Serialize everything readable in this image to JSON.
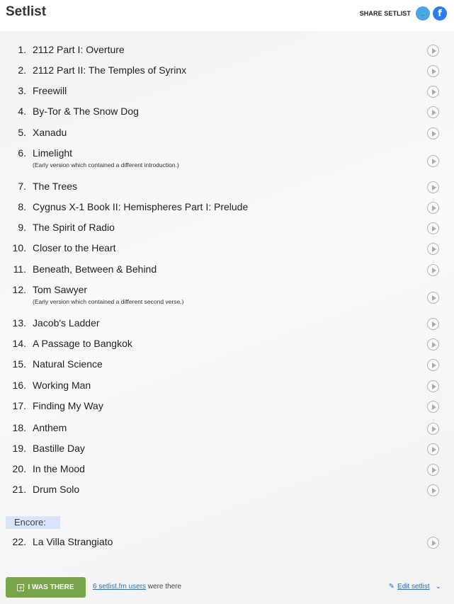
{
  "header": {
    "title": "Setlist",
    "share_label": "SHARE SETLIST",
    "twitter_glyph": "🐦",
    "facebook_glyph": "f"
  },
  "songs": [
    {
      "num": "1.",
      "title": "2112 Part I: Overture"
    },
    {
      "num": "2.",
      "title": "2112 Part II: The Temples of Syrinx"
    },
    {
      "num": "3.",
      "title": "Freewill"
    },
    {
      "num": "4.",
      "title": "By-Tor & The Snow Dog"
    },
    {
      "num": "5.",
      "title": "Xanadu"
    },
    {
      "num": "6.",
      "title": "Limelight",
      "info": "(Early version which contained a different introduction.)"
    },
    {
      "num": "7.",
      "title": "The Trees"
    },
    {
      "num": "8.",
      "title": "Cygnus X-1 Book II: Hemispheres Part I: Prelude"
    },
    {
      "num": "9.",
      "title": "The Spirit of Radio"
    },
    {
      "num": "10.",
      "title": "Closer to the Heart"
    },
    {
      "num": "11.",
      "title": "Beneath, Between & Behind"
    },
    {
      "num": "12.",
      "title": "Tom Sawyer",
      "info": "(Early version which contained a different second verse.)"
    },
    {
      "num": "13.",
      "title": "Jacob's Ladder"
    },
    {
      "num": "14.",
      "title": "A Passage to Bangkok"
    },
    {
      "num": "15.",
      "title": "Natural Science"
    },
    {
      "num": "16.",
      "title": "Working Man"
    },
    {
      "num": "17.",
      "title": "Finding My Way"
    },
    {
      "num": "18.",
      "title": "Anthem"
    },
    {
      "num": "19.",
      "title": "Bastille Day"
    },
    {
      "num": "20.",
      "title": "In the Mood"
    },
    {
      "num": "21.",
      "title": "Drum Solo"
    }
  ],
  "encore": {
    "label": "Encore:",
    "songs": [
      {
        "num": "22.",
        "title": "La Villa Strangiato"
      }
    ]
  },
  "footer": {
    "i_was_there": "I WAS THERE",
    "users_link": "6 setlist.fm users",
    "users_suffix": " were there",
    "edit_label": "Edit setlist",
    "edit_icon": "✎",
    "chevron": "⌄"
  },
  "colors": {
    "button_green": "#79a54b",
    "link_blue": "#2a6ebb",
    "encore_bg": "#d6e6f7",
    "twitter": "#4aa3ec",
    "facebook": "#2d7cf0"
  }
}
